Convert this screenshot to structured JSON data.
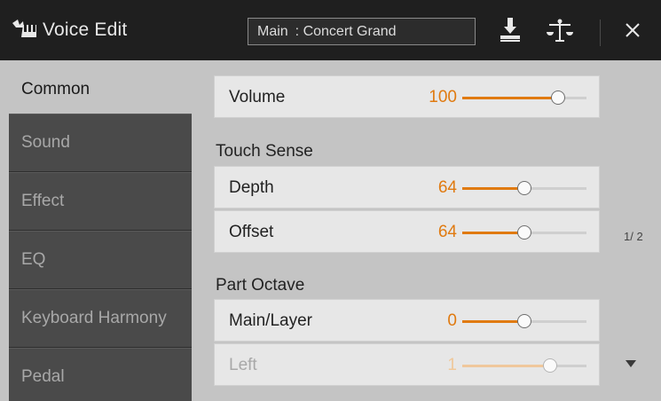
{
  "header": {
    "title": "Voice Edit",
    "voice_display": "Main : Concert Grand",
    "icons": [
      "keyboard-voice-icon",
      "save-icon",
      "balance-icon",
      "close-icon"
    ]
  },
  "sidebar": {
    "tabs": [
      {
        "label": "Common",
        "active": true
      },
      {
        "label": "Sound",
        "active": false
      },
      {
        "label": "Effect",
        "active": false
      },
      {
        "label": "EQ",
        "active": false
      },
      {
        "label": "Keyboard Harmony",
        "active": false
      },
      {
        "label": "Pedal",
        "active": false
      }
    ]
  },
  "main": {
    "volume": {
      "label": "Volume",
      "value": "100",
      "level": 0.77
    },
    "touch_sense": {
      "heading": "Touch Sense",
      "depth": {
        "label": "Depth",
        "value": "64",
        "level": 0.5
      },
      "offset": {
        "label": "Offset",
        "value": "64",
        "level": 0.5
      }
    },
    "part_octave": {
      "heading": "Part Octave",
      "main_layer": {
        "label": "Main/Layer",
        "value": "0",
        "level": 0.5
      },
      "left": {
        "label": "Left",
        "value": "1",
        "level": 0.71
      }
    }
  },
  "pagination": {
    "indicator": "1/ 2"
  },
  "colors": {
    "accent": "#e07a10",
    "title_bar": "#1f1f1f",
    "sidebar": "#4a4a4a",
    "background": "#c4c4c4"
  }
}
